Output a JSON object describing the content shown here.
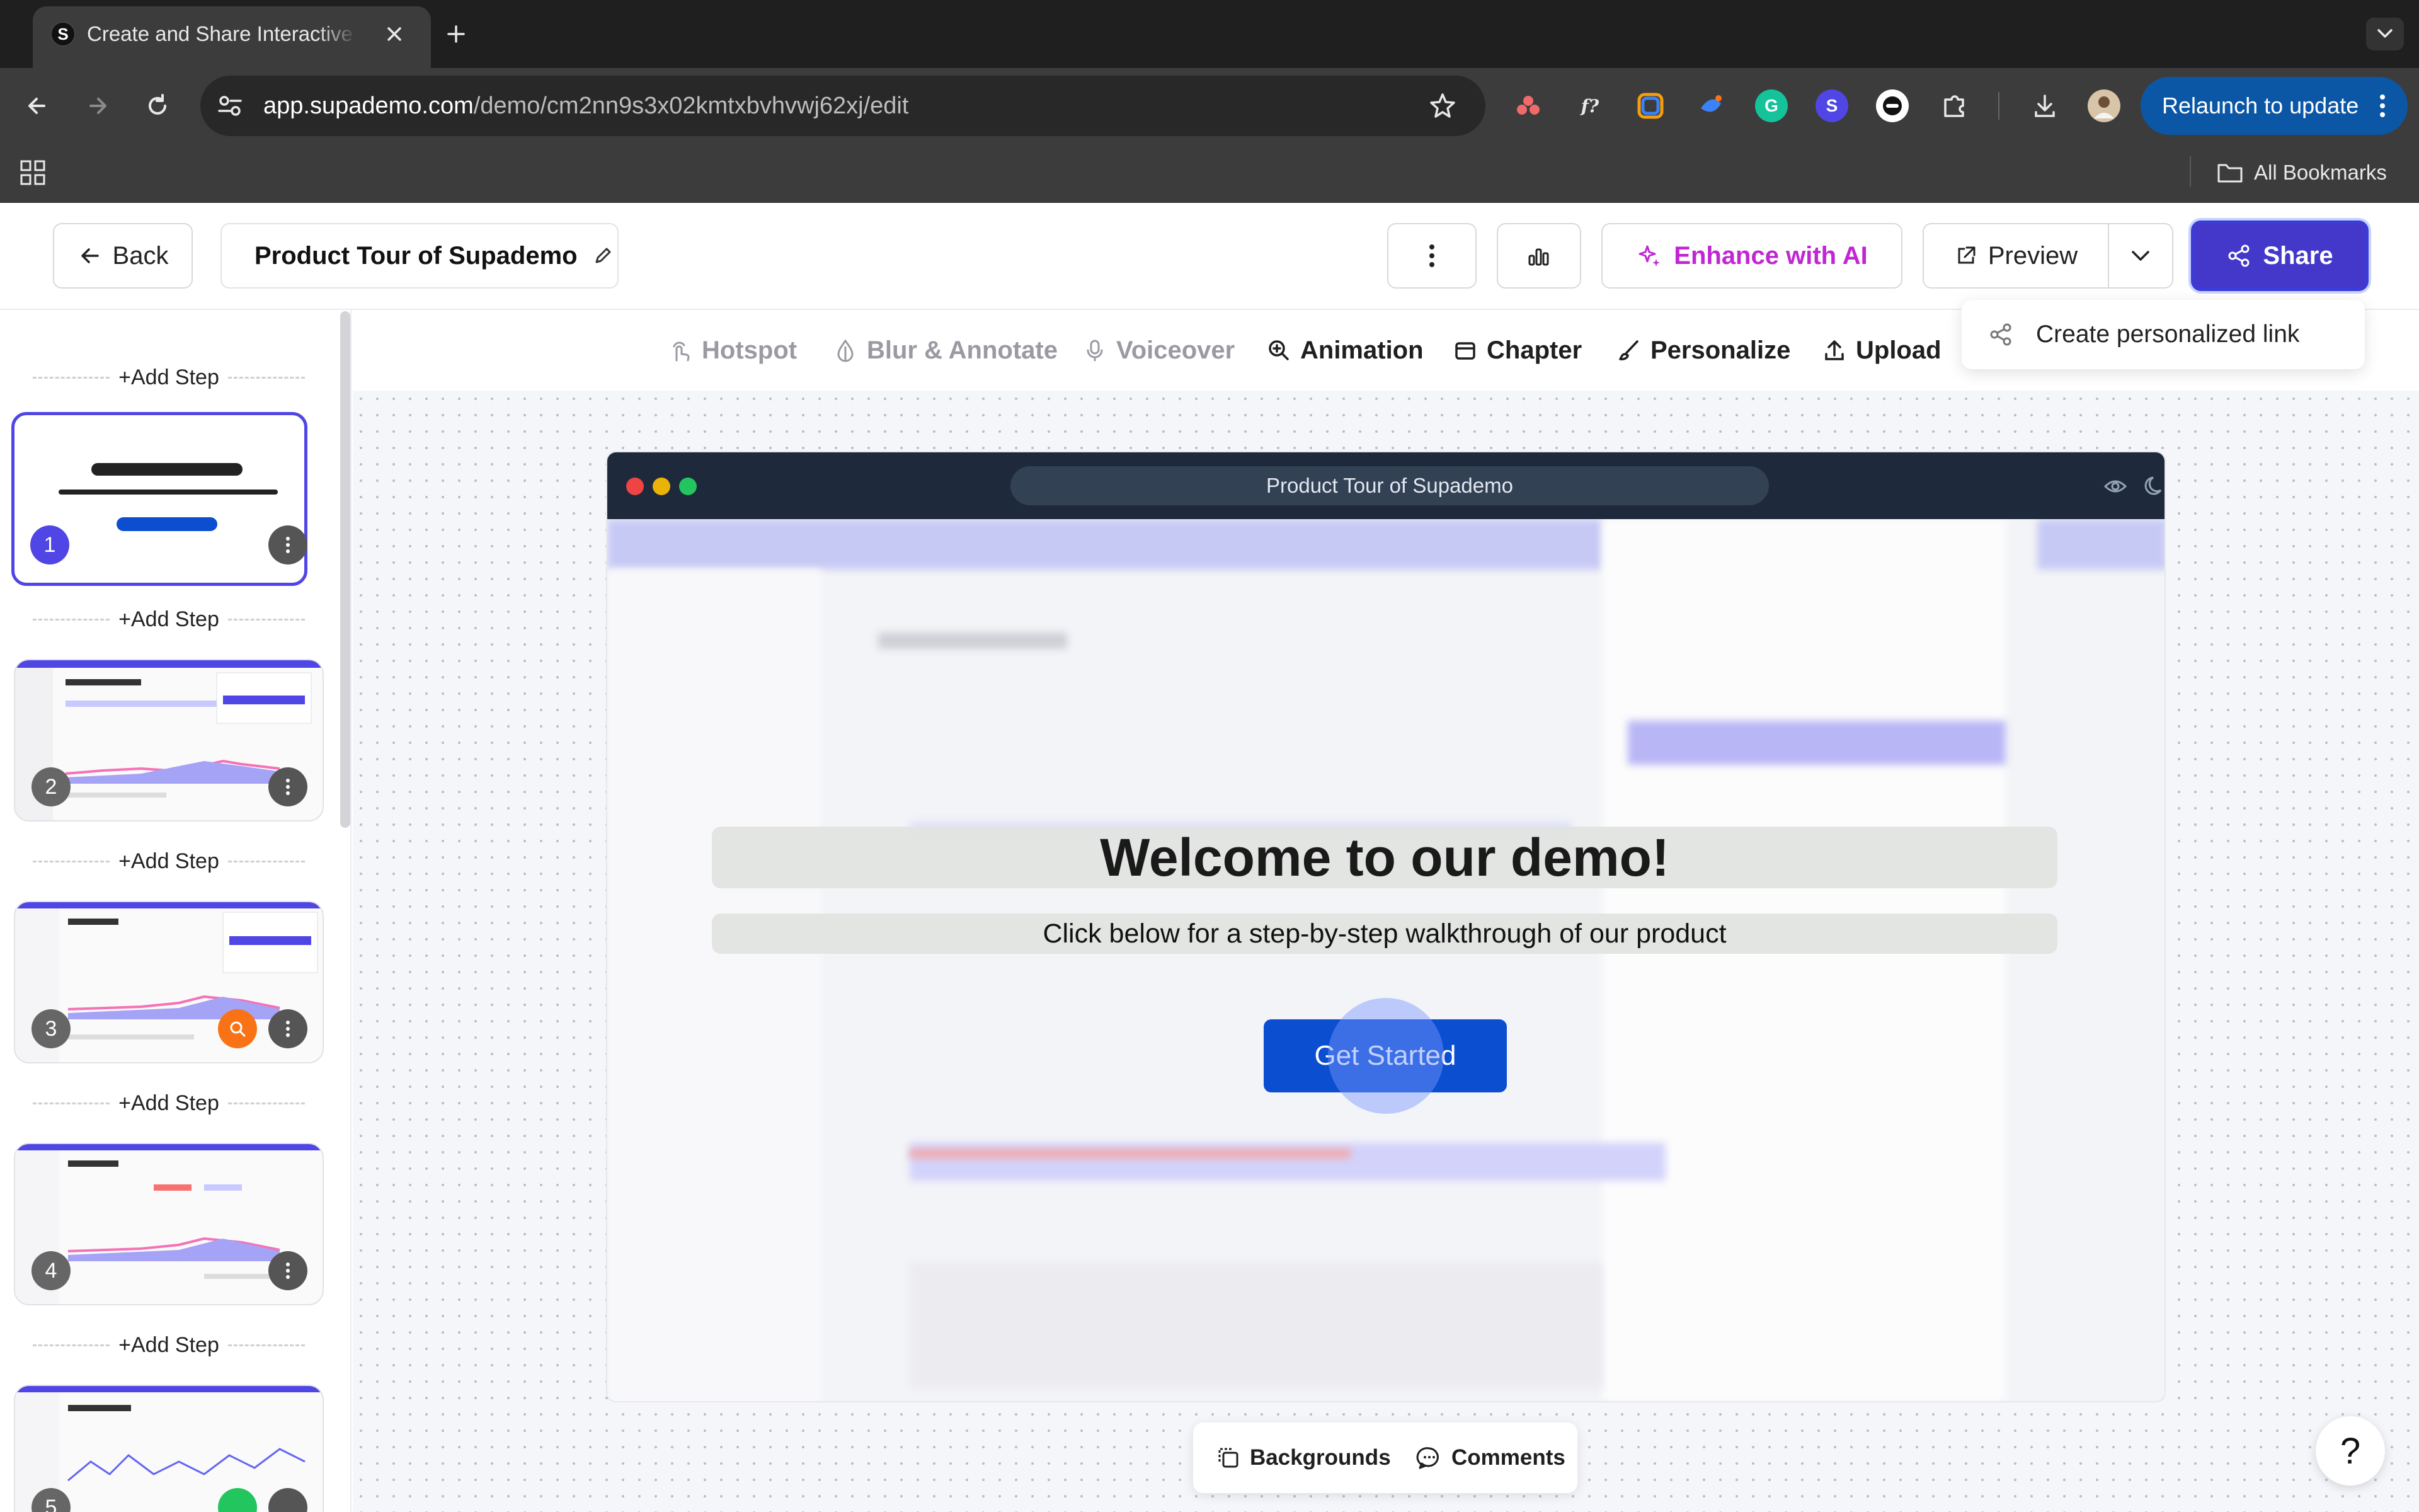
{
  "browser": {
    "tab": {
      "favicon_letter": "S",
      "title": "Create and Share Interactive Product Demos"
    },
    "url": {
      "host": "app.supademo.com",
      "path": "/demo/cm2nn9s3x02kmtxbvhvwj62xj/edit"
    },
    "extensions": [
      "asana-icon",
      "fx-icon",
      "color-picker-icon",
      "ai-assistant-icon",
      "grammarly-icon",
      "supademo-extension-icon",
      "focus-icon",
      "extensions-puzzle-icon"
    ],
    "relaunch_label": "Relaunch to update",
    "all_bookmarks_label": "All Bookmarks"
  },
  "header": {
    "back_label": "Back",
    "demo_title": "Product Tour of Supademo",
    "enhance_label": "Enhance with AI",
    "preview_label": "Preview",
    "share_label": "Share"
  },
  "share_menu": {
    "item_label": "Create personalized link"
  },
  "toolbar": {
    "hotspot": "Hotspot",
    "blur": "Blur & Annotate",
    "voiceover": "Voiceover",
    "animation": "Animation",
    "chapter": "Chapter",
    "personalize": "Personalize",
    "upload": "Upload"
  },
  "sidebar": {
    "add_step_label": "Add Step",
    "steps": [
      {
        "number": "1"
      },
      {
        "number": "2"
      },
      {
        "number": "3"
      },
      {
        "number": "4"
      },
      {
        "number": "5"
      }
    ]
  },
  "demo": {
    "window_title": "Product Tour of Supademo",
    "welcome_title": "Welcome to our demo!",
    "welcome_subtitle": "Click below for a step-by-step walkthrough of our product",
    "cta_label": "Get Started"
  },
  "dock": {
    "backgrounds_label": "Backgrounds",
    "comments_label": "Comments"
  },
  "help_label": "?",
  "colors": {
    "accent": "#4338ca",
    "cta": "#0b4fd0",
    "enhance": "#c026d3",
    "browser_dark": "#3c3c3c"
  }
}
